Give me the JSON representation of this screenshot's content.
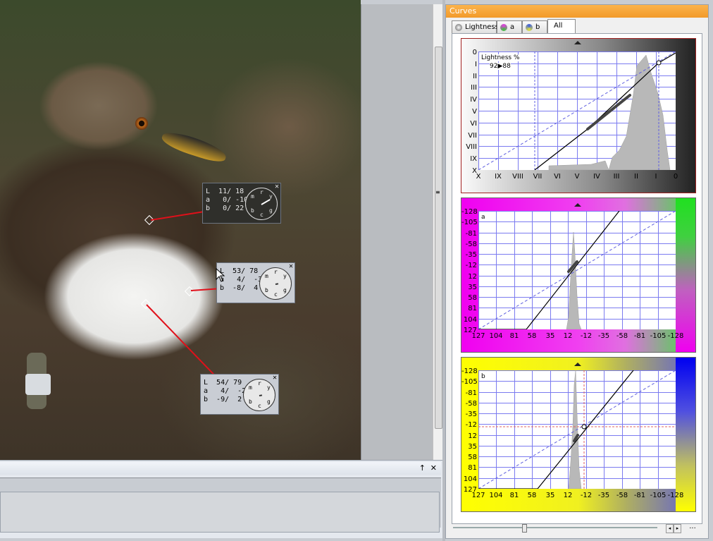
{
  "curves_panel": {
    "title": "Curves",
    "tabs": [
      {
        "label": "Lightness",
        "icon": "lightness-channel-icon"
      },
      {
        "label": "a",
        "icon": "a-channel-icon"
      },
      {
        "label": "b",
        "icon": "b-channel-icon"
      },
      {
        "label": "All",
        "icon": ""
      }
    ],
    "active_tab": "All",
    "lightness_graph": {
      "label": "Lightness %",
      "readout": "92▶88",
      "y_ticks": [
        "0",
        "I",
        "II",
        "III",
        "IV",
        "V",
        "VI",
        "VII",
        "VIII",
        "IX",
        "X"
      ],
      "x_ticks": [
        "X",
        "IX",
        "VIII",
        "VII",
        "VI",
        "V",
        "IV",
        "III",
        "II",
        "I",
        "0"
      ]
    },
    "a_graph": {
      "label": "a",
      "y_ticks": [
        "-128",
        "-105",
        "-81",
        "-58",
        "-35",
        "-12",
        "12",
        "35",
        "58",
        "81",
        "104",
        "127"
      ],
      "x_ticks": [
        "127",
        "104",
        "81",
        "58",
        "35",
        "12",
        "-12",
        "-35",
        "-58",
        "-81",
        "-105",
        "-128"
      ]
    },
    "b_graph": {
      "label": "b",
      "y_ticks": [
        "-128",
        "-105",
        "-81",
        "-58",
        "-35",
        "-12",
        "12",
        "35",
        "58",
        "81",
        "104",
        "127"
      ],
      "x_ticks": [
        "127",
        "104",
        "81",
        "58",
        "35",
        "12",
        "-12",
        "-35",
        "-58",
        "-81",
        "-105",
        "-128"
      ]
    },
    "bottom_button": "..."
  },
  "samplers": [
    {
      "L": "L  11/ 18",
      "a": "a   0/ -10",
      "b": "b   0/ 22",
      "dial": [
        "m",
        "r",
        "y",
        "b",
        "c",
        "g"
      ]
    },
    {
      "L": "L  53/ 78",
      "a": "a   4/  -3",
      "b": "b  -8/  4",
      "dial": [
        "m",
        "r",
        "y",
        "b",
        "c",
        "g"
      ]
    },
    {
      "L": "L  54/ 79",
      "a": "a   4/  -2",
      "b": "b  -9/  2",
      "dial": [
        "m",
        "r",
        "y",
        "b",
        "c",
        "g"
      ]
    }
  ],
  "bottom_panel": {
    "pin": "↑",
    "close": "✕"
  },
  "close_glyph": "✕",
  "colors": {
    "title_orange": "#f29a2a",
    "magenta": "#ff00ff",
    "green": "#00e000",
    "yellow": "#ffff00",
    "blue": "#0000ff",
    "curve_red": "#e0101a"
  }
}
